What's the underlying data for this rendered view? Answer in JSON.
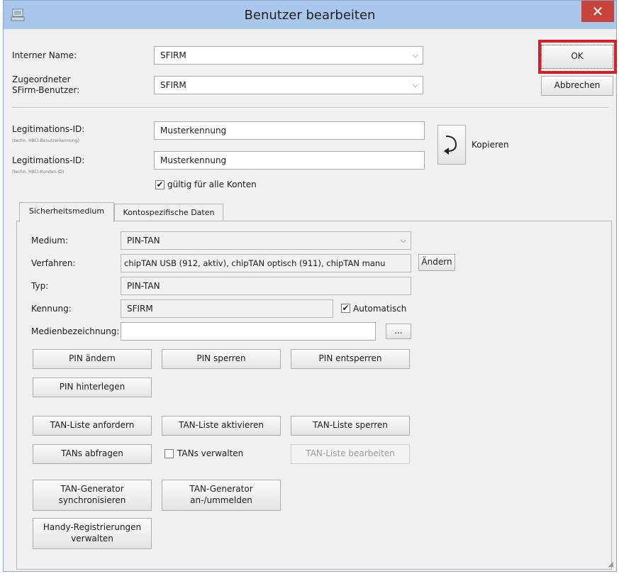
{
  "window": {
    "title": "Benutzer bearbeiten",
    "close_glyph": "✕"
  },
  "header": {
    "internal_name_label": "Interner Name:",
    "internal_name_value": "SFIRM",
    "assigned_user_label_line1": "Zugeordneter",
    "assigned_user_label_line2": "SFirm-Benutzer:",
    "assigned_user_value": "SFIRM",
    "ok_label": "OK",
    "cancel_label": "Abbrechen"
  },
  "legitimation": {
    "id1_label": "Legitimations-ID:",
    "id1_sublabel": "(techn. HBCI-Benutzerkennung)",
    "id1_value": "Musterkennung",
    "id2_label": "Legitimations-ID:",
    "id2_sublabel": "(techn. HBCI-Kunden-ID)",
    "id2_value": "Musterkennung",
    "copy_label": "Kopieren",
    "all_accounts_label": "gültig für alle Konten",
    "all_accounts_checked": true
  },
  "tabs": [
    {
      "label": "Sicherheitsmedium",
      "active": true
    },
    {
      "label": "Kontospezifische Daten",
      "active": false
    }
  ],
  "security": {
    "medium_label": "Medium:",
    "medium_value": "PIN-TAN",
    "procedure_label": "Verfahren:",
    "procedure_value": "chipTAN USB (912, aktiv), chipTAN optisch (911), chipTAN manu",
    "change_label": "Ändern",
    "type_label": "Typ:",
    "type_value": "PIN-TAN",
    "id_label": "Kennung:",
    "id_value": "SFIRM",
    "automatic_label": "Automatisch",
    "automatic_checked": true,
    "media_name_label": "Medienbezeichnung:",
    "media_name_value": "",
    "browse_label": "..."
  },
  "buttons": {
    "pin_change": "PIN ändern",
    "pin_lock": "PIN sperren",
    "pin_unlock": "PIN entsperren",
    "pin_store": "PIN hinterlegen",
    "tan_list_request": "TAN-Liste anfordern",
    "tan_list_activate": "TAN-Liste aktivieren",
    "tan_list_lock": "TAN-Liste sperren",
    "tans_query": "TANs abfragen",
    "tans_manage": "TANs verwalten",
    "tans_manage_checked": false,
    "tan_list_edit": "TAN-Liste bearbeiten",
    "tan_gen_sync_line1": "TAN-Generator",
    "tan_gen_sync_line2": "synchronisieren",
    "tan_gen_register_line1": "TAN-Generator",
    "tan_gen_register_line2": "an-/ummelden",
    "mobile_reg_line1": "Handy-Registrierungen",
    "mobile_reg_line2": "verwalten"
  },
  "colors": {
    "titlebar": "#a9c7ec",
    "close": "#c7433c",
    "highlight": "#d71f2a"
  },
  "icons": [
    "app-icon",
    "close-icon",
    "copy-arrow-icon",
    "chevron-down-icon",
    "checkmark-icon"
  ]
}
